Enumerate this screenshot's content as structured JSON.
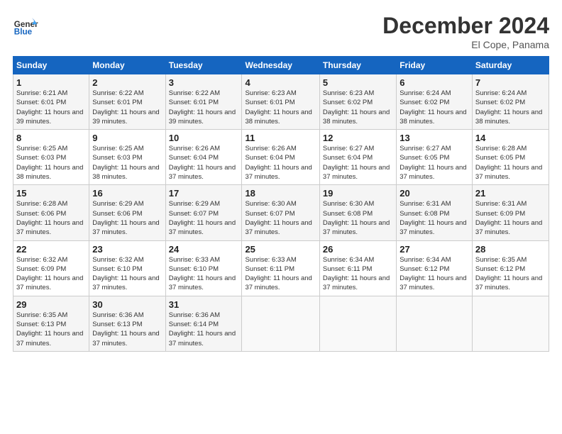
{
  "header": {
    "logo_general": "General",
    "logo_blue": "Blue",
    "month_title": "December 2024",
    "location": "El Cope, Panama"
  },
  "weekdays": [
    "Sunday",
    "Monday",
    "Tuesday",
    "Wednesday",
    "Thursday",
    "Friday",
    "Saturday"
  ],
  "weeks": [
    [
      {
        "day": "1",
        "sunrise": "6:21 AM",
        "sunset": "6:01 PM",
        "daylight": "11 hours and 39 minutes."
      },
      {
        "day": "2",
        "sunrise": "6:22 AM",
        "sunset": "6:01 PM",
        "daylight": "11 hours and 39 minutes."
      },
      {
        "day": "3",
        "sunrise": "6:22 AM",
        "sunset": "6:01 PM",
        "daylight": "11 hours and 39 minutes."
      },
      {
        "day": "4",
        "sunrise": "6:23 AM",
        "sunset": "6:01 PM",
        "daylight": "11 hours and 38 minutes."
      },
      {
        "day": "5",
        "sunrise": "6:23 AM",
        "sunset": "6:02 PM",
        "daylight": "11 hours and 38 minutes."
      },
      {
        "day": "6",
        "sunrise": "6:24 AM",
        "sunset": "6:02 PM",
        "daylight": "11 hours and 38 minutes."
      },
      {
        "day": "7",
        "sunrise": "6:24 AM",
        "sunset": "6:02 PM",
        "daylight": "11 hours and 38 minutes."
      }
    ],
    [
      {
        "day": "8",
        "sunrise": "6:25 AM",
        "sunset": "6:03 PM",
        "daylight": "11 hours and 38 minutes."
      },
      {
        "day": "9",
        "sunrise": "6:25 AM",
        "sunset": "6:03 PM",
        "daylight": "11 hours and 38 minutes."
      },
      {
        "day": "10",
        "sunrise": "6:26 AM",
        "sunset": "6:04 PM",
        "daylight": "11 hours and 37 minutes."
      },
      {
        "day": "11",
        "sunrise": "6:26 AM",
        "sunset": "6:04 PM",
        "daylight": "11 hours and 37 minutes."
      },
      {
        "day": "12",
        "sunrise": "6:27 AM",
        "sunset": "6:04 PM",
        "daylight": "11 hours and 37 minutes."
      },
      {
        "day": "13",
        "sunrise": "6:27 AM",
        "sunset": "6:05 PM",
        "daylight": "11 hours and 37 minutes."
      },
      {
        "day": "14",
        "sunrise": "6:28 AM",
        "sunset": "6:05 PM",
        "daylight": "11 hours and 37 minutes."
      }
    ],
    [
      {
        "day": "15",
        "sunrise": "6:28 AM",
        "sunset": "6:06 PM",
        "daylight": "11 hours and 37 minutes."
      },
      {
        "day": "16",
        "sunrise": "6:29 AM",
        "sunset": "6:06 PM",
        "daylight": "11 hours and 37 minutes."
      },
      {
        "day": "17",
        "sunrise": "6:29 AM",
        "sunset": "6:07 PM",
        "daylight": "11 hours and 37 minutes."
      },
      {
        "day": "18",
        "sunrise": "6:30 AM",
        "sunset": "6:07 PM",
        "daylight": "11 hours and 37 minutes."
      },
      {
        "day": "19",
        "sunrise": "6:30 AM",
        "sunset": "6:08 PM",
        "daylight": "11 hours and 37 minutes."
      },
      {
        "day": "20",
        "sunrise": "6:31 AM",
        "sunset": "6:08 PM",
        "daylight": "11 hours and 37 minutes."
      },
      {
        "day": "21",
        "sunrise": "6:31 AM",
        "sunset": "6:09 PM",
        "daylight": "11 hours and 37 minutes."
      }
    ],
    [
      {
        "day": "22",
        "sunrise": "6:32 AM",
        "sunset": "6:09 PM",
        "daylight": "11 hours and 37 minutes."
      },
      {
        "day": "23",
        "sunrise": "6:32 AM",
        "sunset": "6:10 PM",
        "daylight": "11 hours and 37 minutes."
      },
      {
        "day": "24",
        "sunrise": "6:33 AM",
        "sunset": "6:10 PM",
        "daylight": "11 hours and 37 minutes."
      },
      {
        "day": "25",
        "sunrise": "6:33 AM",
        "sunset": "6:11 PM",
        "daylight": "11 hours and 37 minutes."
      },
      {
        "day": "26",
        "sunrise": "6:34 AM",
        "sunset": "6:11 PM",
        "daylight": "11 hours and 37 minutes."
      },
      {
        "day": "27",
        "sunrise": "6:34 AM",
        "sunset": "6:12 PM",
        "daylight": "11 hours and 37 minutes."
      },
      {
        "day": "28",
        "sunrise": "6:35 AM",
        "sunset": "6:12 PM",
        "daylight": "11 hours and 37 minutes."
      }
    ],
    [
      {
        "day": "29",
        "sunrise": "6:35 AM",
        "sunset": "6:13 PM",
        "daylight": "11 hours and 37 minutes."
      },
      {
        "day": "30",
        "sunrise": "6:36 AM",
        "sunset": "6:13 PM",
        "daylight": "11 hours and 37 minutes."
      },
      {
        "day": "31",
        "sunrise": "6:36 AM",
        "sunset": "6:14 PM",
        "daylight": "11 hours and 37 minutes."
      },
      null,
      null,
      null,
      null
    ]
  ]
}
